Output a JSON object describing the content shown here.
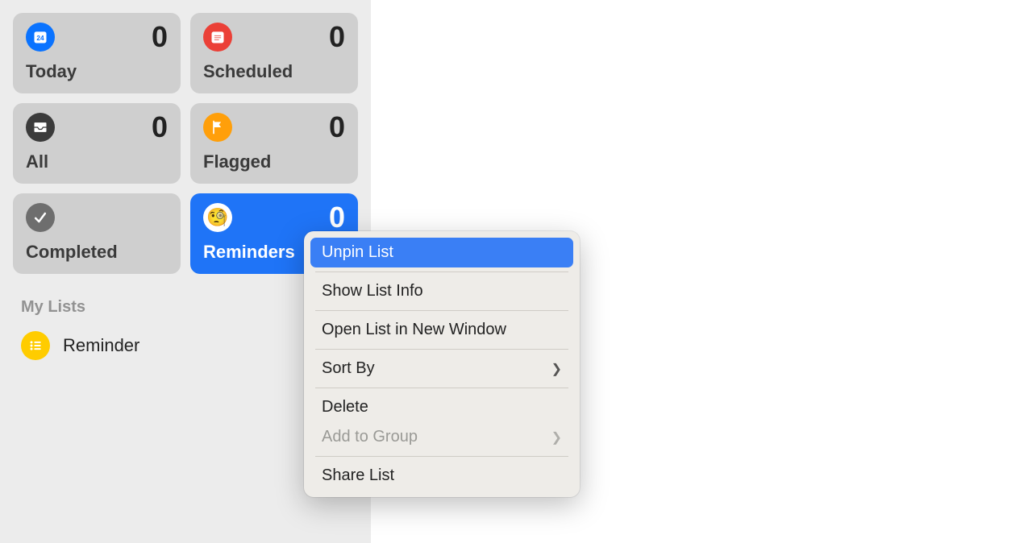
{
  "sidebar": {
    "cards": {
      "today": {
        "label": "Today",
        "count": "0"
      },
      "scheduled": {
        "label": "Scheduled",
        "count": "0"
      },
      "all": {
        "label": "All",
        "count": "0"
      },
      "flagged": {
        "label": "Flagged",
        "count": "0"
      },
      "completed": {
        "label": "Completed"
      },
      "reminders": {
        "label": "Reminders",
        "count": "0"
      }
    },
    "section_title": "My Lists",
    "lists": [
      {
        "label": "Reminder"
      }
    ]
  },
  "context_menu": {
    "items": {
      "unpin": {
        "label": "Unpin List"
      },
      "info": {
        "label": "Show List Info"
      },
      "open_win": {
        "label": "Open List in New Window"
      },
      "sort_by": {
        "label": "Sort By"
      },
      "delete": {
        "label": "Delete"
      },
      "add_group": {
        "label": "Add to Group"
      },
      "share": {
        "label": "Share List"
      }
    }
  },
  "colors": {
    "accent": "#1f74f7",
    "today": "#0a73ff",
    "scheduled": "#eb4037",
    "flagged": "#ff9f0a",
    "all": "#3b3b3b",
    "completed": "#6e6e6e",
    "list": "#ffcc00"
  }
}
